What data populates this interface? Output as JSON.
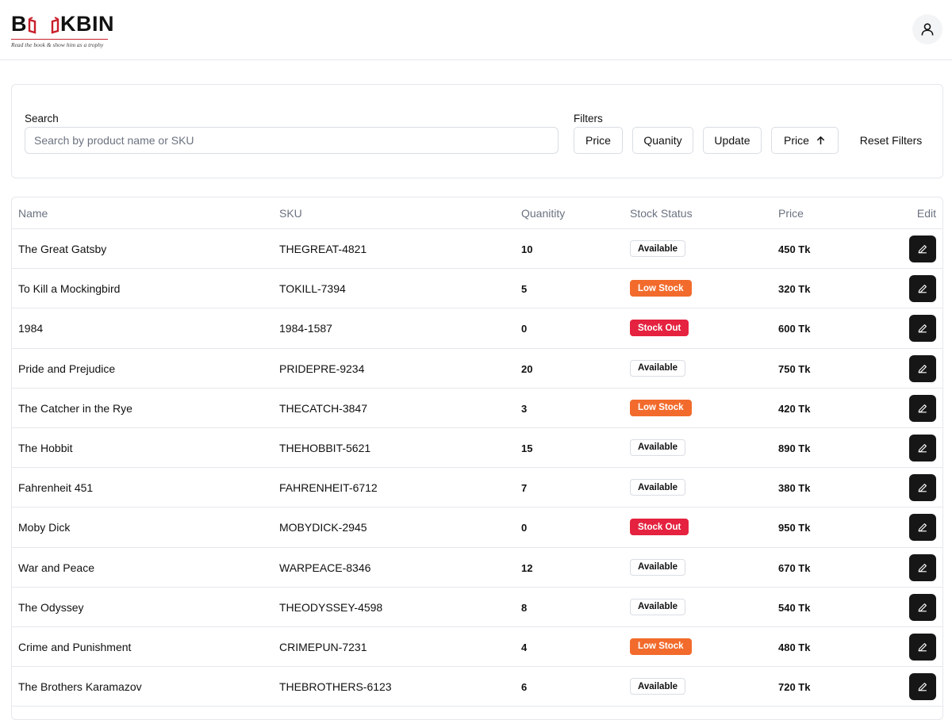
{
  "brand": {
    "name_start": "B",
    "name_end": "KBIN",
    "tagline": "Read the book & show him as a trophy",
    "accent": "#c81e2a"
  },
  "header": {
    "profile_icon": "user-icon"
  },
  "search": {
    "label": "Search",
    "placeholder": "Search by product name or SKU",
    "value": ""
  },
  "filters": {
    "label": "Filters",
    "buttons": [
      "Price",
      "Quanity",
      "Update"
    ],
    "sort_button": {
      "label": "Price",
      "icon": "arrow-up-icon"
    },
    "reset_label": "Reset Filters"
  },
  "table": {
    "columns": [
      "Name",
      "SKU",
      "Quanitity",
      "Stock Status",
      "Price",
      "Edit"
    ],
    "rows": [
      {
        "name": "The Great Gatsby",
        "sku": "THEGREAT-4821",
        "qty": "10",
        "status": "Available",
        "price": "450 Tk"
      },
      {
        "name": "To Kill a Mockingbird",
        "sku": "TOKILL-7394",
        "qty": "5",
        "status": "Low Stock",
        "price": "320 Tk"
      },
      {
        "name": "1984",
        "sku": "1984-1587",
        "qty": "0",
        "status": "Stock Out",
        "price": "600 Tk"
      },
      {
        "name": "Pride and Prejudice",
        "sku": "PRIDEPRE-9234",
        "qty": "20",
        "status": "Available",
        "price": "750 Tk"
      },
      {
        "name": "The Catcher in the Rye",
        "sku": "THECATCH-3847",
        "qty": "3",
        "status": "Low Stock",
        "price": "420 Tk"
      },
      {
        "name": "The Hobbit",
        "sku": "THEHOBBIT-5621",
        "qty": "15",
        "status": "Available",
        "price": "890 Tk"
      },
      {
        "name": "Fahrenheit 451",
        "sku": "FAHRENHEIT-6712",
        "qty": "7",
        "status": "Available",
        "price": "380 Tk"
      },
      {
        "name": "Moby Dick",
        "sku": "MOBYDICK-2945",
        "qty": "0",
        "status": "Stock Out",
        "price": "950 Tk"
      },
      {
        "name": "War and Peace",
        "sku": "WARPEACE-8346",
        "qty": "12",
        "status": "Available",
        "price": "670 Tk"
      },
      {
        "name": "The Odyssey",
        "sku": "THEODYSSEY-4598",
        "qty": "8",
        "status": "Available",
        "price": "540 Tk"
      },
      {
        "name": "Crime and Punishment",
        "sku": "CRIMEPUN-7231",
        "qty": "4",
        "status": "Low Stock",
        "price": "480 Tk"
      },
      {
        "name": "The Brothers Karamazov",
        "sku": "THEBROTHERS-6123",
        "qty": "6",
        "status": "Available",
        "price": "720 Tk"
      }
    ],
    "status_colors": {
      "Available": "#ffffff",
      "Low Stock": "#f26b2c",
      "Stock Out": "#e5223f"
    },
    "edit_icon": "pencil-icon"
  }
}
